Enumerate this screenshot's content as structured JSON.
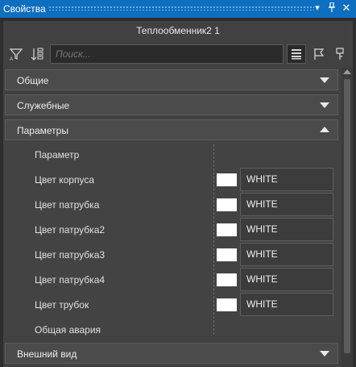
{
  "window": {
    "title": "Свойства",
    "icons": [
      "dropdown-icon",
      "pin-icon",
      "close-icon"
    ]
  },
  "object": {
    "name": "Теплообменник2 1"
  },
  "toolbar": {
    "search_placeholder": "Поиск..."
  },
  "sections": {
    "general": "Общие",
    "service": "Служебные",
    "parameters": "Параметры",
    "appearance": "Внешний вид"
  },
  "parameters": {
    "header_label": "Параметр",
    "rows": [
      {
        "name": "Цвет корпуса",
        "value": "WHITE",
        "color": "#ffffff"
      },
      {
        "name": "Цвет патрубка",
        "value": "WHITE",
        "color": "#ffffff"
      },
      {
        "name": "Цвет патрубка2",
        "value": "WHITE",
        "color": "#ffffff"
      },
      {
        "name": "Цвет патрубка3",
        "value": "WHITE",
        "color": "#ffffff"
      },
      {
        "name": "Цвет патрубка4",
        "value": "WHITE",
        "color": "#ffffff"
      },
      {
        "name": "Цвет трубок",
        "value": "WHITE",
        "color": "#ffffff"
      }
    ],
    "last_row": "Общая авария"
  },
  "colors": {
    "titlebar": "#0e6fc0",
    "panel": "#414141"
  }
}
